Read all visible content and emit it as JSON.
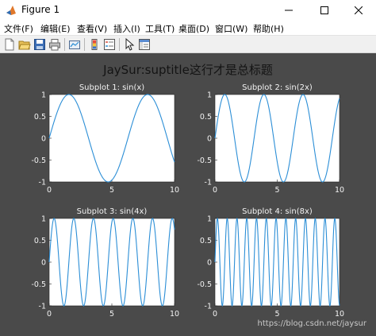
{
  "window": {
    "title": "Figure 1",
    "controls": {
      "minimize": "minimize-icon",
      "maximize": "maximize-icon",
      "close": "close-icon"
    }
  },
  "menu": [
    {
      "label": "文件(F)"
    },
    {
      "label": "编辑(E)"
    },
    {
      "label": "查看(V)"
    },
    {
      "label": "插入(I)"
    },
    {
      "label": "工具(T)"
    },
    {
      "label": "桌面(D)"
    },
    {
      "label": "窗口(W)"
    },
    {
      "label": "帮助(H)"
    }
  ],
  "toolbar": [
    "new-figure-icon",
    "open-file-icon",
    "save-icon",
    "print-icon",
    "link-plot-icon",
    "insert-colorbar-icon",
    "insert-legend-icon",
    "pointer-icon",
    "property-inspector-icon"
  ],
  "colors": {
    "figure_bg": "#4a4a4a",
    "axes_bg": "#ffffff",
    "line": "#2b8ed6"
  },
  "figure": {
    "suptitle": "JaySur:suptitle这行才是总标题"
  },
  "chart_data": [
    {
      "type": "line",
      "title": "Subplot 1: sin(x)",
      "function": "sin(x)",
      "freq": 1,
      "xlim": [
        0,
        10
      ],
      "ylim": [
        -1,
        1
      ],
      "xticks": [
        "0",
        "5",
        "10"
      ],
      "yticks": [
        "1",
        "0.5",
        "0",
        "-0.5",
        "-1"
      ],
      "grid": false
    },
    {
      "type": "line",
      "title": "Subplot 2: sin(2x)",
      "function": "sin(2x)",
      "freq": 2,
      "xlim": [
        0,
        10
      ],
      "ylim": [
        -1,
        1
      ],
      "xticks": [
        "0",
        "5",
        "10"
      ],
      "yticks": [
        "1",
        "0.5",
        "0",
        "-0.5",
        "-1"
      ],
      "grid": false
    },
    {
      "type": "line",
      "title": "Subplot 3: sin(4x)",
      "function": "sin(4x)",
      "freq": 4,
      "xlim": [
        0,
        10
      ],
      "ylim": [
        -1,
        1
      ],
      "xticks": [
        "0",
        "5",
        "10"
      ],
      "yticks": [
        "1",
        "0.5",
        "0",
        "-0.5",
        "-1"
      ],
      "grid": false
    },
    {
      "type": "line",
      "title": "Subplot 4: sin(8x)",
      "function": "sin(8x)",
      "freq": 8,
      "xlim": [
        0,
        10
      ],
      "ylim": [
        -1,
        1
      ],
      "xticks": [
        "0",
        "5",
        "10"
      ],
      "yticks": [
        "1",
        "0.5",
        "0",
        "-0.5",
        "-1"
      ],
      "grid": false
    }
  ],
  "watermark": "https://blog.csdn.net/jaysur"
}
